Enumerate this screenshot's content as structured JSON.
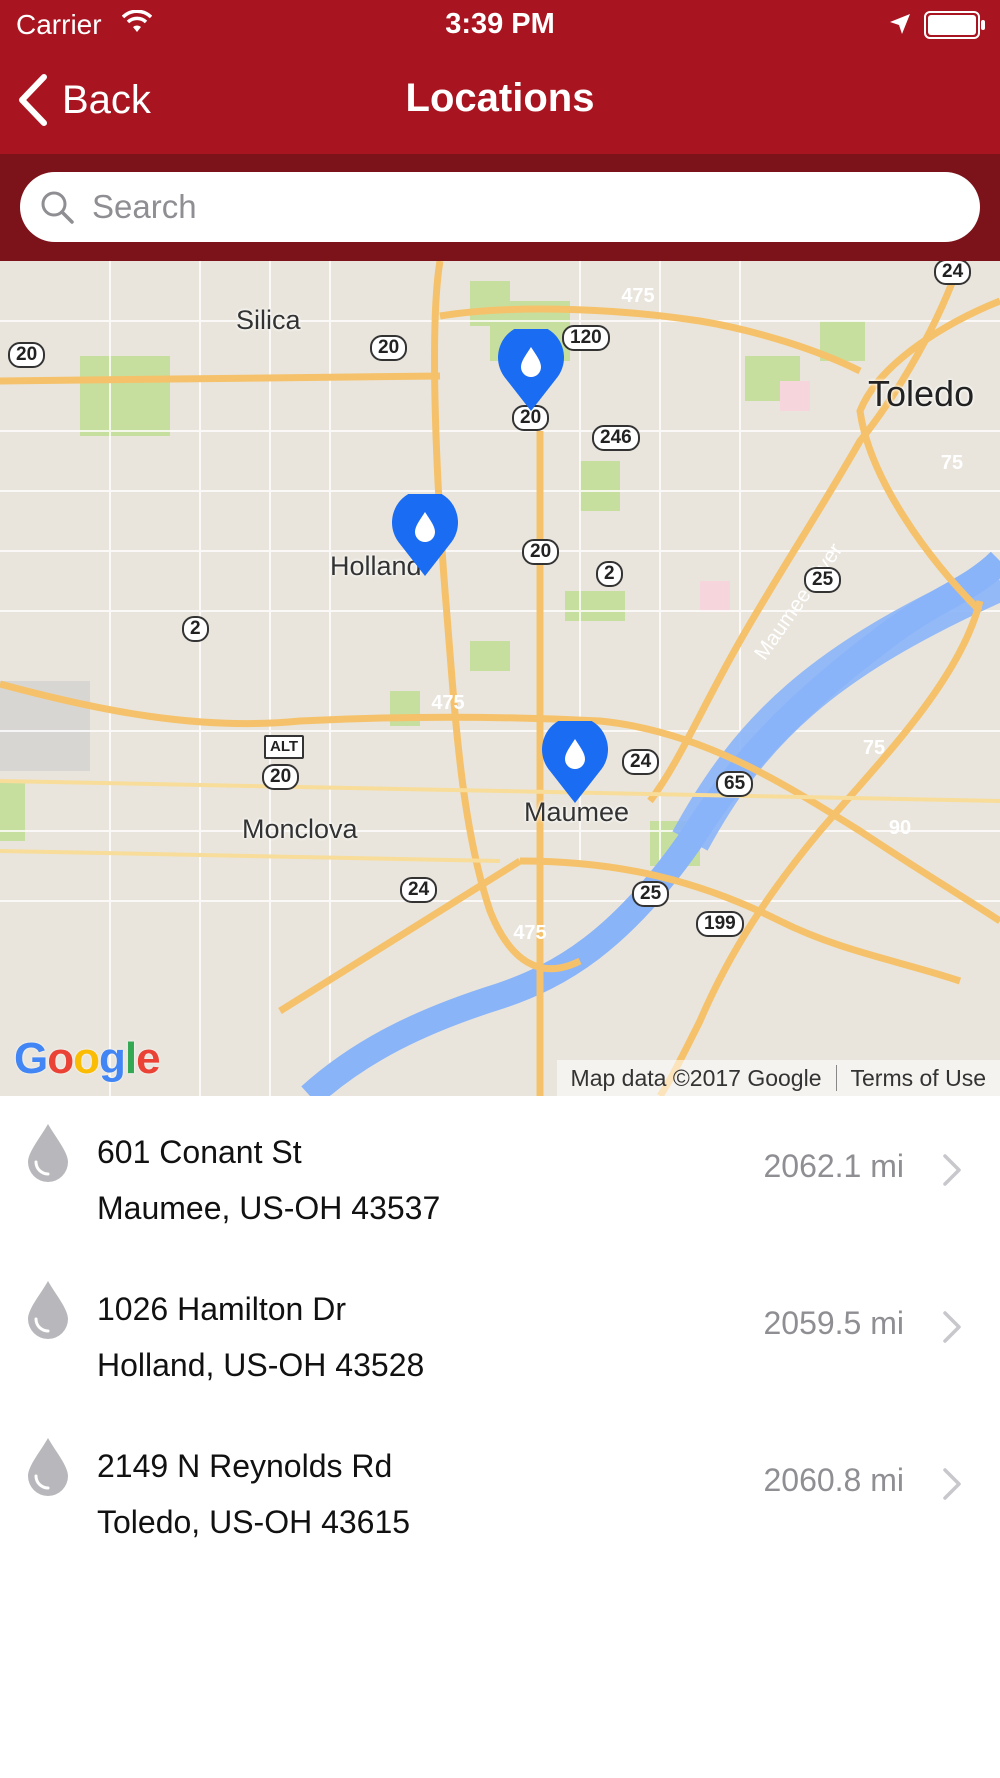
{
  "status_bar": {
    "carrier": "Carrier",
    "time": "3:39 PM"
  },
  "nav": {
    "back_label": "Back",
    "title": "Locations"
  },
  "search": {
    "placeholder": "Search"
  },
  "map": {
    "labels": {
      "silica": "Silica",
      "toledo": "Toledo",
      "holland": "Holland",
      "monclova": "Monclova",
      "maumee": "Maumee",
      "maumee_river": "Maumee River"
    },
    "shields": [
      "20",
      "20",
      "20",
      "20",
      "120",
      "246",
      "2",
      "2",
      "25",
      "24",
      "24",
      "65",
      "25",
      "199",
      "24",
      "20",
      "ALT"
    ],
    "interstates": [
      "475",
      "75",
      "475",
      "75",
      "90",
      "475"
    ],
    "google_logo": "Google",
    "attribution": "Map data ©2017 Google",
    "terms": "Terms of Use"
  },
  "locations": [
    {
      "street": "601 Conant St",
      "city_line": "Maumee, US-OH 43537",
      "distance": "2062.1 mi"
    },
    {
      "street": "1026 Hamilton Dr",
      "city_line": "Holland, US-OH 43528",
      "distance": "2059.5 mi"
    },
    {
      "street": "2149 N Reynolds Rd",
      "city_line": "Toledo, US-OH 43615",
      "distance": "2060.8 mi"
    }
  ],
  "colors": {
    "nav_red": "#a8141f",
    "search_band": "#7d131a",
    "pin_blue": "#1a6cf2"
  }
}
